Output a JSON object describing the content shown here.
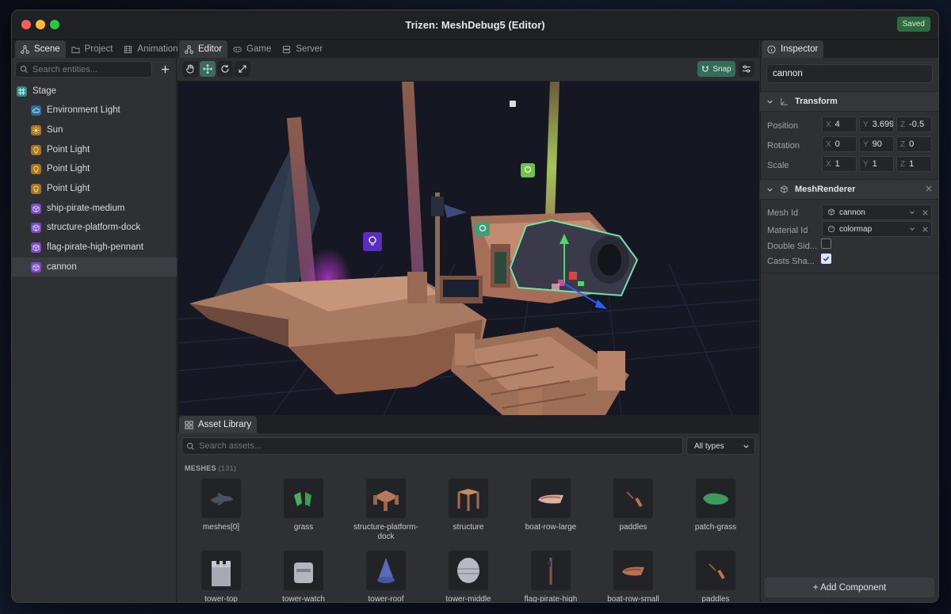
{
  "window": {
    "title": "Trizen: MeshDebug5 (Editor)",
    "status": "Saved"
  },
  "left_tabs": [
    {
      "label": "Scene",
      "icon": "graph-icon"
    },
    {
      "label": "Project",
      "icon": "folder-icon"
    },
    {
      "label": "Animation",
      "icon": "film-icon"
    }
  ],
  "center_tabs": [
    {
      "label": "Editor",
      "icon": "graph-icon"
    },
    {
      "label": "Game",
      "icon": "gamepad-icon"
    },
    {
      "label": "Server",
      "icon": "server-icon"
    }
  ],
  "right_tabs": [
    {
      "label": "Inspector",
      "icon": "info-icon"
    }
  ],
  "scene": {
    "search_placeholder": "Search entities...",
    "add_icon": "plus-icon",
    "entities": [
      {
        "label": "Stage",
        "icon": "grid-icon",
        "color": "#2f8f86"
      },
      {
        "label": "Environment Light",
        "icon": "cloud-icon",
        "color": "#2d6f9c"
      },
      {
        "label": "Sun",
        "icon": "sun-icon",
        "color": "#a8761e"
      },
      {
        "label": "Point Light",
        "icon": "bulb-icon",
        "color": "#a8761e"
      },
      {
        "label": "Point Light",
        "icon": "bulb-icon",
        "color": "#a8761e"
      },
      {
        "label": "Point Light",
        "icon": "bulb-icon",
        "color": "#a8761e"
      },
      {
        "label": "ship-pirate-medium",
        "icon": "cube-icon",
        "color": "#7a4bc9"
      },
      {
        "label": "structure-platform-dock",
        "icon": "cube-icon",
        "color": "#7a4bc9"
      },
      {
        "label": "flag-pirate-high-pennant",
        "icon": "cube-icon",
        "color": "#7a4bc9"
      },
      {
        "label": "cannon",
        "icon": "cube-icon",
        "color": "#7a4bc9"
      }
    ],
    "selected": "cannon"
  },
  "toolbar": {
    "tools": [
      "hand-icon",
      "move-icon",
      "rotate-icon",
      "scale-icon"
    ],
    "active_tool": "move-icon",
    "snap_label": "Snap",
    "settings_icon": "sliders-icon"
  },
  "inspector": {
    "name_value": "cannon",
    "transform": {
      "title": "Transform",
      "position": {
        "label": "Position",
        "x": "4",
        "y": "3.699",
        "z": "-0.5"
      },
      "rotation": {
        "label": "Rotation",
        "x": "0",
        "y": "90",
        "z": "0"
      },
      "scale": {
        "label": "Scale",
        "x": "1",
        "y": "1",
        "z": "1"
      }
    },
    "mesh_renderer": {
      "title": "MeshRenderer",
      "mesh_id_label": "Mesh Id",
      "mesh_id": "cannon",
      "material_id_label": "Material Id",
      "material_id": "colormap",
      "double_sided_label": "Double Sid...",
      "double_sided": false,
      "casts_shadows_label": "Casts Sha...",
      "casts_shadows": true
    },
    "add_component": "+ Add Component"
  },
  "assets": {
    "tab": "Asset Library",
    "search_placeholder": "Search assets...",
    "filter": "All types",
    "section": "MESHES",
    "count": "(131)",
    "items": [
      {
        "label": "meshes[0]"
      },
      {
        "label": "grass"
      },
      {
        "label": "structure-platform-dock"
      },
      {
        "label": "structure"
      },
      {
        "label": "boat-row-large"
      },
      {
        "label": "paddles"
      },
      {
        "label": "patch-grass"
      },
      {
        "label": "tower-top"
      },
      {
        "label": "tower-watch"
      },
      {
        "label": "tower-roof"
      },
      {
        "label": "tower-middle"
      },
      {
        "label": "flag-pirate-high"
      },
      {
        "label": "boat-row-small"
      },
      {
        "label": "paddles"
      }
    ]
  }
}
